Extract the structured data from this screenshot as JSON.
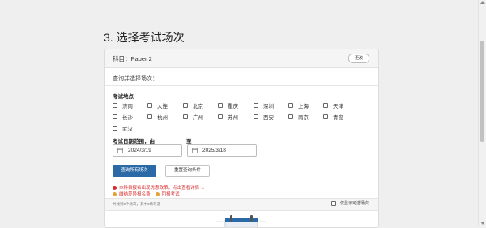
{
  "page": {
    "title": "3. 选择考试场次"
  },
  "card": {
    "subject": "科目：Paper 2",
    "change_label": "更改",
    "query_hint": "查询并选择场次："
  },
  "location": {
    "label": "考试地点",
    "cities": [
      "济南",
      "大连",
      "北京",
      "重庆",
      "深圳",
      "上海",
      "天津",
      "长沙",
      "杭州",
      "广州",
      "苏州",
      "西安",
      "南京",
      "青岛",
      "武汉"
    ]
  },
  "date_range": {
    "from_label": "考试日期范围，由",
    "to_label": "至",
    "from_value": "2024/3/19",
    "to_value": "2025/3/18",
    "calendar_icon": "calendar-icon"
  },
  "buttons": {
    "search": "查询所有场次",
    "reset": "重置查询条件"
  },
  "notices": {
    "line1": "本科目报名出现优惠政策，点击查看详情 →",
    "line2a": "缴纳差异报名费",
    "line2b": "团报考试"
  },
  "results": {
    "summary": "共找到0个场次，其中0场可选",
    "available_only": "仅显示可选场次"
  },
  "colors": {
    "primary": "#2b6aa6",
    "warning": "#d92b2b",
    "orange": "#e6a23c"
  }
}
